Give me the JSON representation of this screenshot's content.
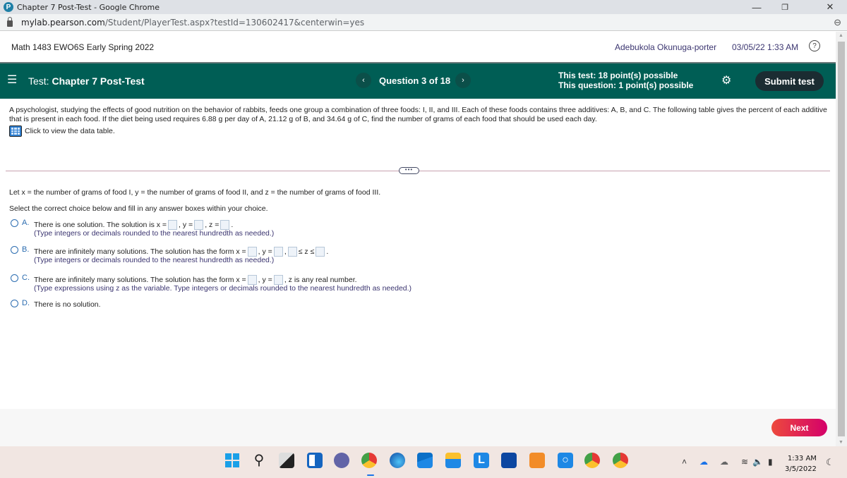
{
  "browser": {
    "window_title": "Chapter 7 Post-Test - Google Chrome",
    "url_host": "mylab.pearson.com",
    "url_path": "/Student/PlayerTest.aspx?testId=130602417&centerwin=yes",
    "controls": {
      "minimize": "—",
      "restore": "❐",
      "close": "✕",
      "zoom": "⊖"
    }
  },
  "header": {
    "course": "Math 1483 EWO6S Early Spring 2022",
    "user": "Adebukola Okunuga-porter",
    "datetime": "03/05/22 1:33 AM",
    "help": "?"
  },
  "testbar": {
    "menu_icon": "☰",
    "test_prefix": "Test:",
    "test_name": "Chapter 7 Post-Test",
    "prev": "‹",
    "question": "Question 3 of 18",
    "next": "›",
    "test_points": "This test: 18 point(s) possible",
    "question_points": "This question: 1 point(s) possible",
    "settings_icon": "⚙",
    "submit_label": "Submit test"
  },
  "question": {
    "text": "A psychologist, studying the effects of good nutrition on the behavior of rabbits, feeds one group a combination of three foods: I, II, and III. Each of these foods contains three additives: A, B, and C. The following table gives the percent of each additive that is present in each food. If the diet being used requires 6.88 g per day of A, 21.12 g of B, and 34.64 g of C, find the number of grams of each food that should be used each day.",
    "table_link": "Click to view the data table.",
    "more": "•••",
    "let_text": "Let x = the number of grams of food I, y = the number of grams of food II, and z = the number of grams of food III.",
    "select_text": "Select the correct choice below and fill in any answer boxes within your choice."
  },
  "choices": [
    {
      "letter": "A.",
      "p1": "There is one solution. The solution is x =",
      "p2": ", y =",
      "p3": ", z =",
      "p4": ".",
      "hint": "(Type integers or decimals rounded to the nearest hundredth as needed.)"
    },
    {
      "letter": "B.",
      "p1": "There are infinitely many solutions. The solution has the form x =",
      "p2": ", y =",
      "p3": ",",
      "p4": "≤ z ≤",
      "p5": ".",
      "hint": "(Type integers or decimals rounded to the nearest hundredth as needed.)"
    },
    {
      "letter": "C.",
      "p1": "There are infinitely many solutions. The solution has the form x =",
      "p2": ", y =",
      "p3": ", z is any real number.",
      "hint": "(Type expressions using z as the variable. Type integers or decimals rounded to the nearest hundredth as needed.)"
    },
    {
      "letter": "D.",
      "p1": "There is no solution."
    }
  ],
  "footer": {
    "next_label": "Next"
  },
  "taskbar": {
    "apps": [
      "start",
      "search",
      "task-view",
      "widgets",
      "teams-chat",
      "chrome",
      "edge",
      "mail",
      "file-explorer",
      "lumen",
      "store",
      "app-orange",
      "cortana",
      "chrome-profile-a",
      "chrome-profile-b"
    ],
    "time": "1:33 AM",
    "date": "3/5/2022"
  }
}
